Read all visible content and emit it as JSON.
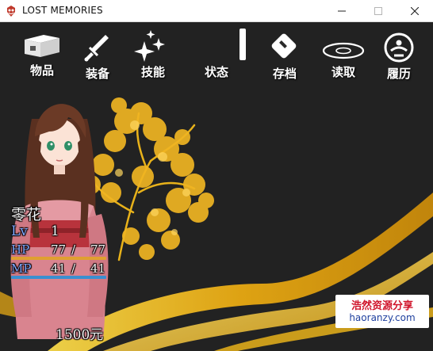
{
  "window": {
    "title": "LOST MEMORIES",
    "app_icon": "game-app-icon",
    "controls": [
      "minimize",
      "maximize",
      "close"
    ]
  },
  "menu": {
    "items": [
      {
        "label": "物品",
        "icon": "item-box-icon"
      },
      {
        "label": "装备",
        "icon": "sword-icon"
      },
      {
        "label": "技能",
        "icon": "sparkle-icon"
      },
      {
        "label": "状态",
        "icon": "status-bar-icon"
      },
      {
        "label": "存档",
        "icon": "save-icon"
      },
      {
        "label": "读取",
        "icon": "load-disc-icon"
      },
      {
        "label": "履历",
        "icon": "history-emblem-icon"
      }
    ]
  },
  "character": {
    "name": "零花",
    "level_label": "Lv",
    "level": "1",
    "hp_label": "HP",
    "hp_current": "77",
    "hp_separator": "/",
    "hp_max": "77",
    "mp_label": "MP",
    "mp_current": "41",
    "mp_separator": "/",
    "mp_max": "41",
    "hp_fraction": 1.0,
    "mp_fraction": 1.0
  },
  "gold": {
    "amount": "1500",
    "unit": "元"
  },
  "watermark": {
    "line1": "浩然资源分享",
    "line2": "haoranzy.com"
  },
  "colors": {
    "background": "#222222",
    "hp_bar": "#e0a030",
    "mp_bar": "#3a8fd0",
    "gold_accent": "#e8b21a",
    "label_blue": "#7fa8ff"
  }
}
